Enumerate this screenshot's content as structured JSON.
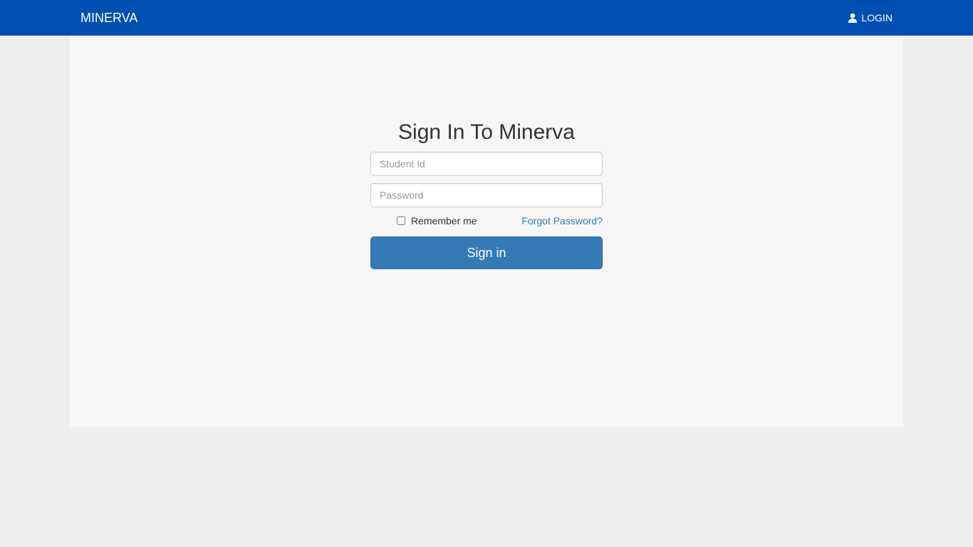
{
  "navbar": {
    "brand": "MINERVA",
    "login_label": "LOGIN",
    "login_icon": "user-icon",
    "background_color": "#004fb3"
  },
  "form": {
    "title": "Sign In To Minerva",
    "student_id": {
      "value": "",
      "placeholder": "Student Id"
    },
    "password": {
      "value": "",
      "placeholder": "Password"
    },
    "remember_label": "Remember me",
    "remember_checked": false,
    "forgot_label": "Forgot Password?",
    "submit_label": "Sign in",
    "submit_color": "#337ab7",
    "link_color": "#337ab7"
  }
}
